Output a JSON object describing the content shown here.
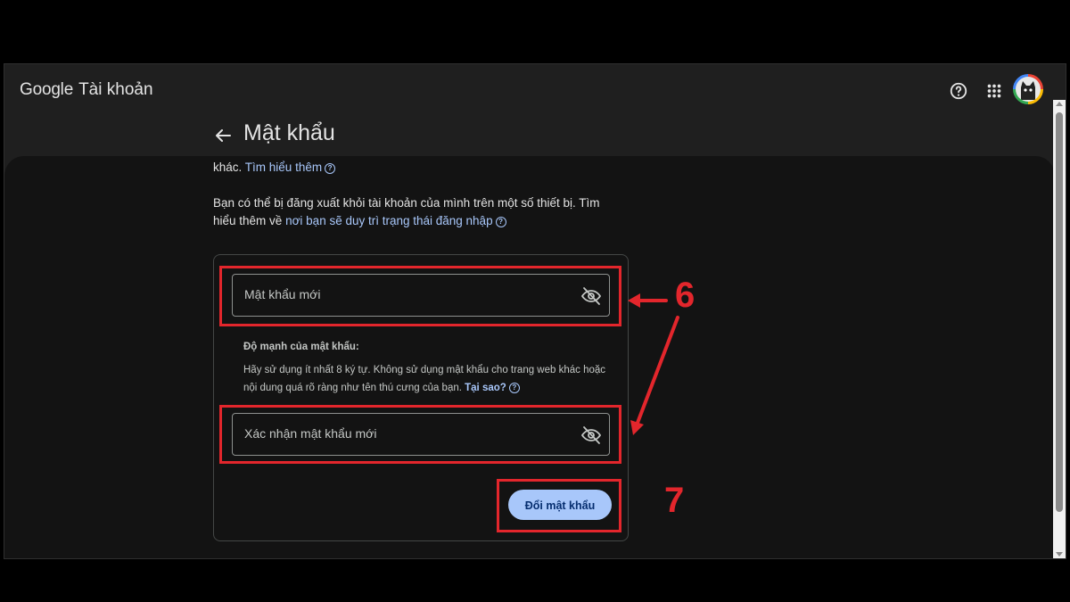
{
  "app": {
    "brand": "Google",
    "product": "Tài khoản"
  },
  "page": {
    "title": "Mật khẩu"
  },
  "paragraphs": {
    "p1_text": "khác.",
    "p1_link": "Tìm hiểu thêm",
    "p2_line1": "Bạn có thể bị đăng xuất khỏi tài khoản của mình trên một số thiết bị. Tìm",
    "p2_line2_prefix": "hiểu thêm về",
    "p2_link": "nơi bạn sẽ duy trì trạng thái đăng nhập"
  },
  "form": {
    "new_password_placeholder": "Mật khẩu mới",
    "strength_title": "Độ mạnh của mật khẩu:",
    "hint_text": "Hãy sử dụng ít nhất 8 ký tự. Không sử dụng mật khẩu cho trang web khác hoặc nội dung quá rõ ràng như tên thú cưng của bạn.",
    "hint_link": "Tại sao?",
    "confirm_placeholder": "Xác nhận mật khẩu mới",
    "submit_label": "Đổi mật khẩu"
  },
  "annotations": {
    "step_fields": "6",
    "step_button": "7"
  },
  "colors": {
    "accent": "#a8c7fa",
    "highlight": "#e3262c",
    "background": "#131313"
  },
  "icons": [
    "help-icon",
    "apps-icon",
    "back-arrow-icon",
    "eye-off-icon"
  ]
}
